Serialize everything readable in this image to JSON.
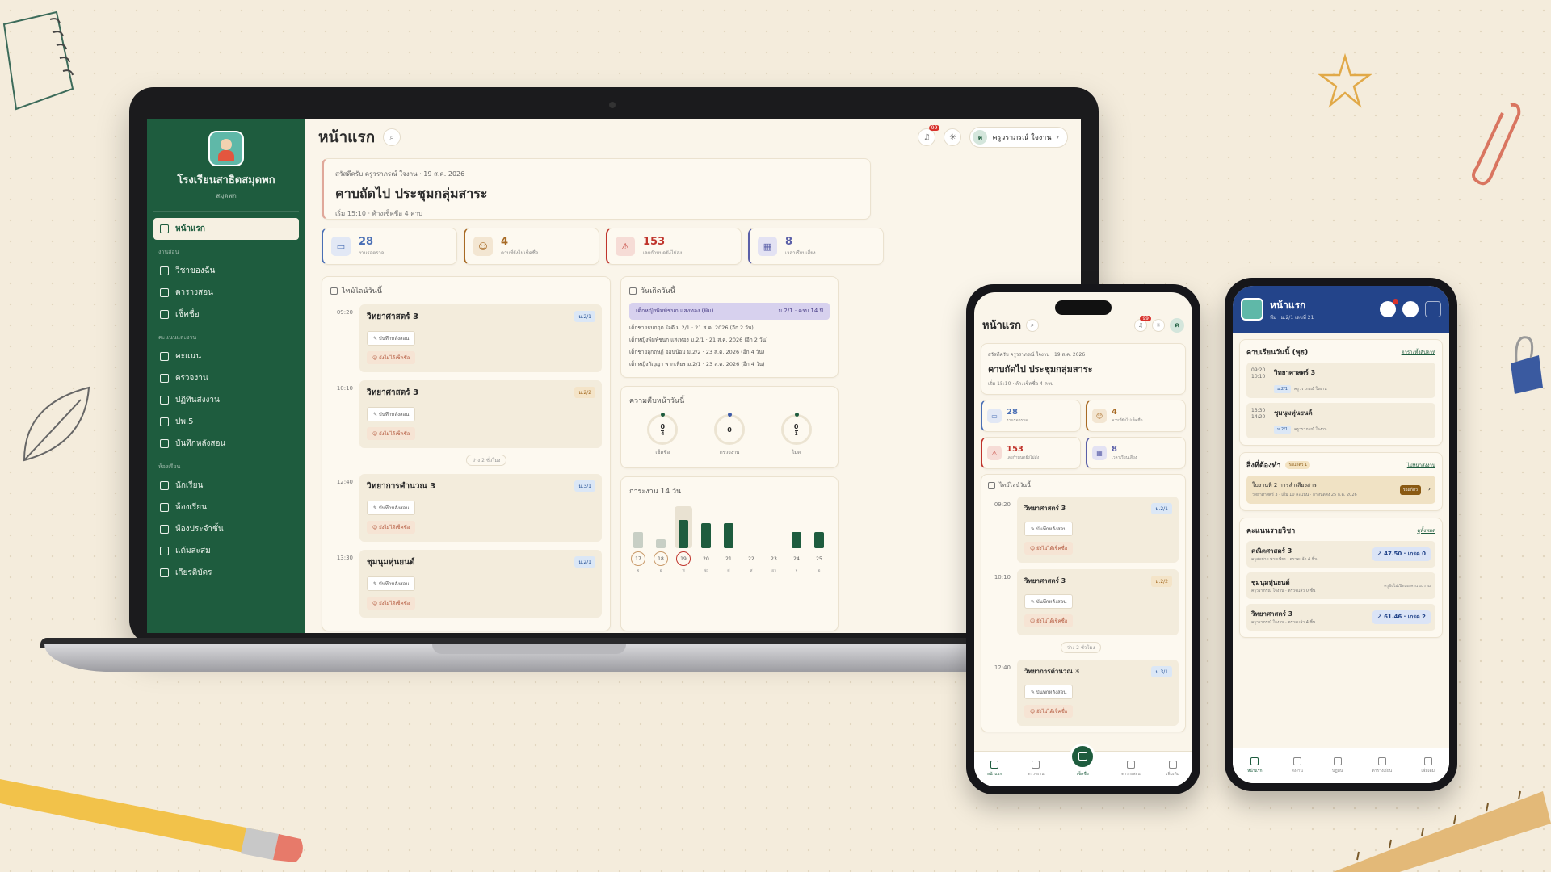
{
  "sidebar": {
    "school_name": "โรงเรียนสาธิตสมุดพก",
    "school_sub": "สมุดพก",
    "items": [
      {
        "label": "หน้าแรก",
        "active": true
      },
      {
        "group": "งานสอน"
      },
      {
        "label": "วิชาของฉัน"
      },
      {
        "label": "ตารางสอน"
      },
      {
        "label": "เช็คชื่อ"
      },
      {
        "group": "คะแนนและงาน"
      },
      {
        "label": "คะแนน"
      },
      {
        "label": "ตรวจงาน"
      },
      {
        "label": "ปฏิทินส่งงาน"
      },
      {
        "label": "ปพ.5"
      },
      {
        "label": "บันทึกหลังสอน"
      },
      {
        "group": "ห้องเรียน"
      },
      {
        "label": "นักเรียน"
      },
      {
        "label": "ห้องเรียน"
      },
      {
        "label": "ห้องประจำชั้น"
      },
      {
        "label": "แต้มสะสม"
      },
      {
        "label": "เกียรติบัตร"
      }
    ]
  },
  "header": {
    "title": "หน้าแรก",
    "notif_count": "99",
    "user_initial": "ค",
    "user_name": "ครูวราภรณ์ ใจงาน"
  },
  "hero": {
    "greet": "สวัสดีครับ ครูวราภรณ์ ใจงาน · 19 ส.ค. 2026",
    "title": "คาบถัดไป ประชุมกลุ่มสาระ",
    "sub": "เริ่ม 15:10 · ค้างเช็คชื่อ 4 คาบ"
  },
  "stats": [
    {
      "value": "28",
      "label": "งานรอตรวจ",
      "icon": "inbox-icon",
      "color": "#4a6fb5",
      "bg": "#e2e8f5"
    },
    {
      "value": "4",
      "label": "คาบที่ยังไม่เช็คชื่อ",
      "icon": "user-check-icon",
      "color": "#a86a24",
      "bg": "#f3e6d2"
    },
    {
      "value": "153",
      "label": "เลยกำหนดยังไม่ส่ง",
      "icon": "alert-icon",
      "color": "#c0342c",
      "bg": "#f6dcd6"
    },
    {
      "value": "8",
      "label": "เวลาเรียนเสี่ยง",
      "icon": "calendar-icon",
      "color": "#5a5fa8",
      "bg": "#e3e2f3"
    }
  ],
  "today": {
    "title": "ไทม์ไลน์วันนี้",
    "slots": [
      {
        "time": "09:20",
        "name": "วิทยาศาสตร์ 3",
        "cls": "ม.2/1",
        "cls_color": "#2a5597",
        "cls_bg": "#dbe7f6",
        "note": "บันทึกหลังสอน",
        "check": "ยังไม่ได้เช็คชื่อ"
      },
      {
        "time": "10:10",
        "name": "วิทยาศาสตร์ 3",
        "cls": "ม.2/2",
        "cls_color": "#a0661c",
        "cls_bg": "#f4e4c8",
        "note": "บันทึกหลังสอน",
        "check": "ยังไม่ได้เช็คชื่อ"
      },
      {
        "time": "12:40",
        "name": "วิทยาการคำนวณ 3",
        "cls": "ม.3/1",
        "cls_color": "#2a5597",
        "cls_bg": "#dbe7f6",
        "note": "บันทึกหลังสอน",
        "check": "ยังไม่ได้เช็คชื่อ"
      },
      {
        "time": "13:30",
        "name": "ชุมนุมหุ่นยนต์",
        "cls": "ม.2/1",
        "cls_color": "#2a5597",
        "cls_bg": "#dbe7f6",
        "note": "บันทึกหลังสอน",
        "check": "ยังไม่ได้เช็คชื่อ"
      }
    ],
    "gap": "ว่าง 2 ชั่วโมง"
  },
  "birthdays": {
    "title": "วันเกิดวันนี้",
    "highlight": "เด็กหญิงพิมพ์ชนก แสงทอง (พิม)",
    "highlight_meta": "ม.2/1 · ครบ 14 ปี",
    "rows": [
      "เด็กชายธนกฤต ใจดี ม.2/1 · 21 ส.ค. 2026 (อีก 2 วัน)",
      "เด็กหญิงพิมพ์ชนก แสงทอง ม.2/1 · 21 ส.ค. 2026 (อีก 2 วัน)",
      "เด็กชายอุกฤษฏ์ อ่อนน้อม ม.2/2 · 23 ส.ค. 2026 (อีก 4 วัน)",
      "เด็กหญิงกัญญา พากเพียร ม.2/1 · 23 ส.ค. 2026 (อีก 4 วัน)"
    ]
  },
  "progress": {
    "title": "ความคืบหน้าวันนี้",
    "rings": [
      {
        "top": "0",
        "bottom": "4",
        "label": "เช็คชื่อ",
        "fraction": 0
      },
      {
        "top": "0",
        "bottom": "",
        "label": "ตรวจงาน",
        "fraction": 0
      },
      {
        "top": "0",
        "bottom": "1",
        "label": "ไม่ต",
        "fraction": 0
      }
    ]
  },
  "attendance": {
    "title": "การะงาน 14 วัน",
    "days": [
      {
        "d": "17",
        "s": "จ",
        "h": 0.45,
        "c": "#c8cfc5",
        "ring": true
      },
      {
        "d": "18",
        "s": "อ",
        "h": 0.25,
        "c": "#c8cfc5",
        "ring": true
      },
      {
        "d": "19",
        "s": "พ",
        "h": 0.8,
        "c": "#1e5c3e",
        "ring": true,
        "today": true
      },
      {
        "d": "20",
        "s": "พฤ",
        "h": 0.7,
        "c": "#1e5c3e"
      },
      {
        "d": "21",
        "s": "ศ",
        "h": 0.7,
        "c": "#1e5c3e"
      },
      {
        "d": "22",
        "s": "ส",
        "h": 0,
        "c": "#1e5c3e"
      },
      {
        "d": "23",
        "s": "อา",
        "h": 0,
        "c": "#1e5c3e"
      },
      {
        "d": "24",
        "s": "จ",
        "h": 0.45,
        "c": "#1e5c3e"
      },
      {
        "d": "25",
        "s": "อ",
        "h": 0.45,
        "c": "#1e5c3e"
      }
    ]
  },
  "phone2": {
    "title": "หน้าแรก",
    "tabs": [
      "หน้าแรก",
      "ตรวจงาน",
      "เช็คชื่อ",
      "ตารางสอน",
      "เพิ่มเติม"
    ]
  },
  "phone3": {
    "title": "หน้าแรก",
    "sub": "พีม · ม.2/1 เลขที่ 21",
    "schedule_title": "คาบเรียนวันนี้ (พุธ)",
    "schedule_link": "ตารางทั้งสัปดาห์",
    "classes": [
      {
        "time": "09:20 10:10",
        "name": "วิทยาศาสตร์ 3",
        "cls": "ม.2/1",
        "teacher": "ครูวราภรณ์ ใจงาน"
      },
      {
        "time": "13:30 14:20",
        "name": "ชุมนุมหุ่นยนต์",
        "cls": "ม.2/1",
        "teacher": "ครูวราภรณ์ ใจงาน"
      }
    ],
    "todo_title": "สิ่งที่ต้องทำ",
    "todo_badge": "รอแก้ตัว 1",
    "todo_link": "ไปหน้าส่งงาน",
    "todo_item": "ใบงานที่ 2 การลำเลียงสาร",
    "todo_meta": "วิทยาศาสตร์ 3 · เต็ม 10 คะแนน · กำหนดส่ง 25 ก.ค. 2026",
    "todo_tag": "รอแก้ตัว",
    "score_title": "คะแนนรายวิชา",
    "score_link": "ดูทั้งหมด",
    "scores": [
      {
        "name": "คณิตศาสตร์ 3",
        "sub": "ครูสมชาย พากเพียร · ตรวจแล้ว 4 ชิ้น",
        "val": "↗ 47.50 · เกรด 0"
      },
      {
        "name": "ชุมนุมหุ่นยนต์",
        "sub": "ครูวราภรณ์ ใจงาน · ตรวจแล้ว 0 ชิ้น",
        "val": "",
        "note": "ครูยังไม่เปิดเผยคะแนนรวม"
      },
      {
        "name": "วิทยาศาสตร์ 3",
        "sub": "ครูวราภรณ์ ใจงาน · ตรวจแล้ว 4 ชิ้น",
        "val": "↗ 61.46 · เกรด 2"
      }
    ],
    "tabs": [
      "หน้าแรก",
      "ส่งงาน",
      "ปฏิทิน",
      "ตารางเรียน",
      "เพิ่มเติม"
    ]
  }
}
